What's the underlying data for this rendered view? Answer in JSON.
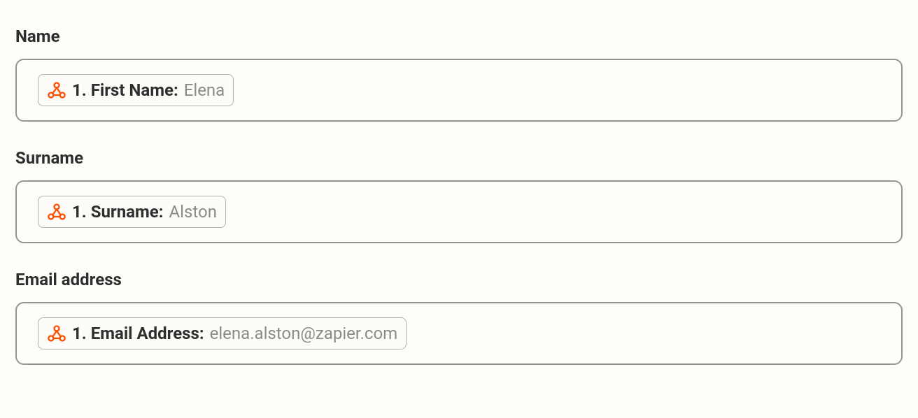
{
  "fields": {
    "name": {
      "label": "Name",
      "pill": {
        "key": "1. First Name:",
        "value": "Elena"
      }
    },
    "surname": {
      "label": "Surname",
      "pill": {
        "key": "1. Surname:",
        "value": "Alston"
      }
    },
    "email": {
      "label": "Email address",
      "pill": {
        "key": "1. Email Address:",
        "value": "elena.alston@zapier.com"
      }
    }
  }
}
